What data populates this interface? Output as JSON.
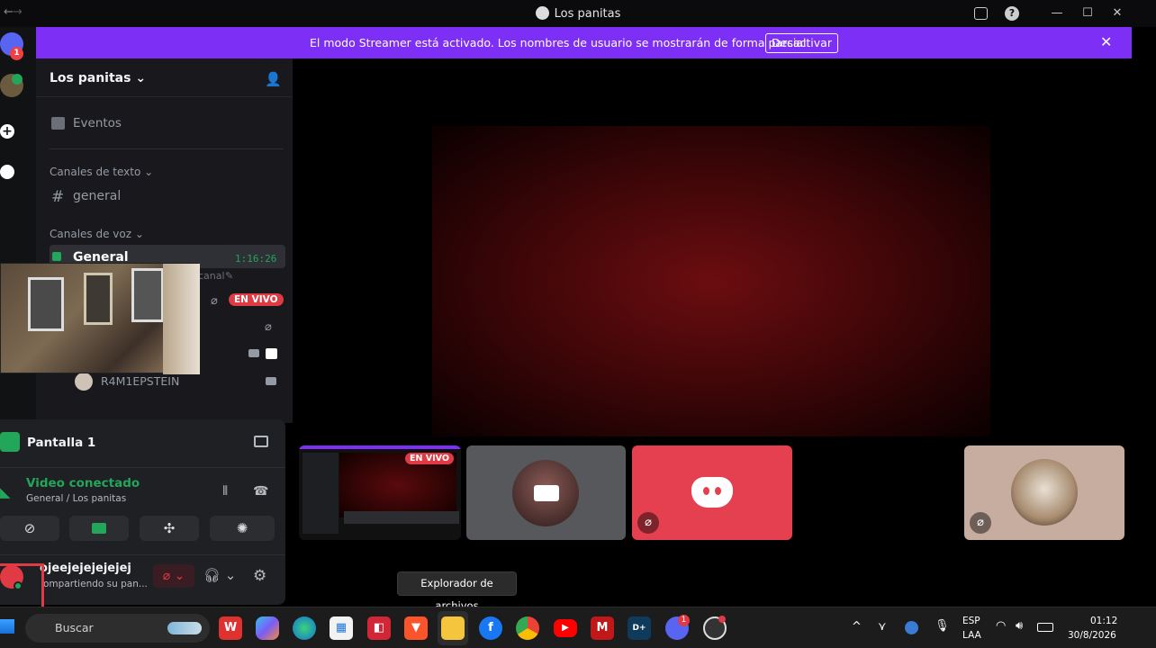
{
  "window": {
    "title": "Los panitas"
  },
  "banner": {
    "message": "El modo Streamer está activado. Los nombres de usuario se mostrarán de forma parcial.",
    "button": "Desactivar"
  },
  "rail": {
    "badge": "1"
  },
  "sidebar": {
    "server_name": "Los panitas",
    "events": "Eventos",
    "text_category": "Canales de texto",
    "text_channel": "general",
    "voice_category": "Canales de voz",
    "voice_channel": "General",
    "voice_timer": "1:16:26",
    "channel_fragment": "canal",
    "live_badge": "EN VIVO",
    "member": "R4M1EPSTEIN"
  },
  "panel": {
    "screen_title": "Pantalla 1",
    "status": "Video conectado",
    "location": "General / Los panitas",
    "username": "ojeejejejejejej",
    "user_status": "ompartiendo su pan..."
  },
  "stage": {
    "tile_live_badge": "EN VIVO"
  },
  "tooltip": "Explorador de archivos",
  "taskbar": {
    "search_placeholder": "Buscar",
    "discord_badge": "1",
    "lang_top": "ESP",
    "lang_bottom": "LAA",
    "time": "01:12",
    "date": "30/8/2026"
  },
  "colors": {
    "accent": "#7e2ff5",
    "live": "#e03b45",
    "discord_red": "#e5404f",
    "online": "#23a55a"
  }
}
